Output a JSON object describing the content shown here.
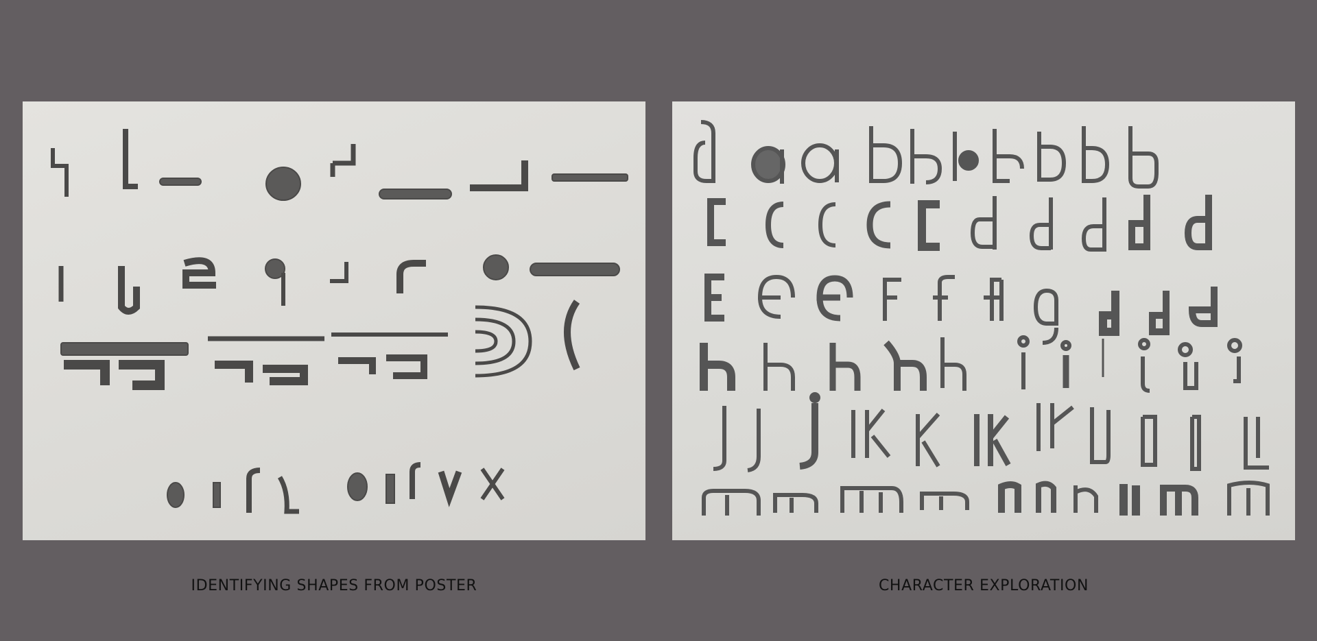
{
  "page": {
    "background": "#635e61"
  },
  "panels": [
    {
      "name": "shapes-from-poster",
      "caption": "IDENTIFYING SHAPES FROM POSTER"
    },
    {
      "name": "character-exploration",
      "caption": "CHARACTER EXPLORATION"
    }
  ]
}
